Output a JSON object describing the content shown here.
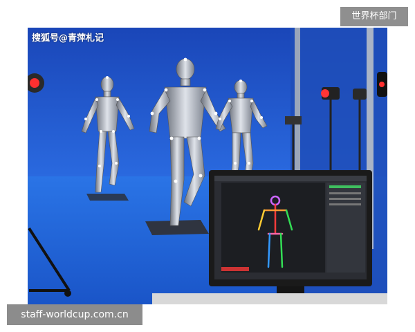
{
  "top_tag": "世界杯部门",
  "bottom_tag": "staff-worldcup.com.cn",
  "photo": {
    "watermark": "搜狐号@青萍札记",
    "subjects": [
      "motion-capture-humanoid",
      "motion-capture-humanoid",
      "motion-capture-humanoid",
      "monitor-with-skeleton-software",
      "studio-lights"
    ]
  },
  "colors": {
    "backdrop": "#1b4fc4",
    "floor": "#1e5fd0",
    "monitor_frame": "#1a1a1a",
    "skeleton_colors": [
      "#ff3b3b",
      "#ffcc33",
      "#33dd55",
      "#3399ff",
      "#cc66ff"
    ]
  }
}
